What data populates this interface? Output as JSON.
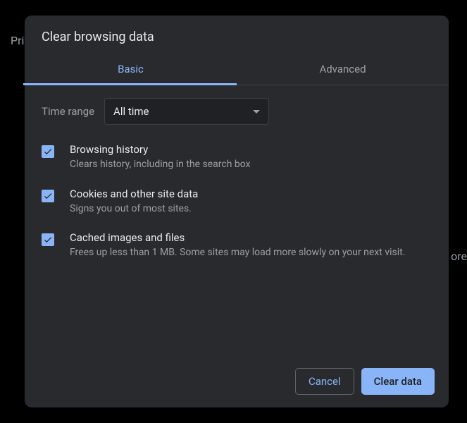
{
  "background": {
    "priv": "Priv",
    "more": "ore"
  },
  "dialog": {
    "title": "Clear browsing data"
  },
  "tabs": {
    "basic": "Basic",
    "advanced": "Advanced"
  },
  "timeRange": {
    "label": "Time range",
    "value": "All time"
  },
  "options": [
    {
      "title": "Browsing history",
      "desc": "Clears history, including in the search box"
    },
    {
      "title": "Cookies and other site data",
      "desc": "Signs you out of most sites."
    },
    {
      "title": "Cached images and files",
      "desc": "Frees up less than 1 MB. Some sites may load more slowly on your next visit."
    }
  ],
  "buttons": {
    "cancel": "Cancel",
    "clear": "Clear data"
  }
}
